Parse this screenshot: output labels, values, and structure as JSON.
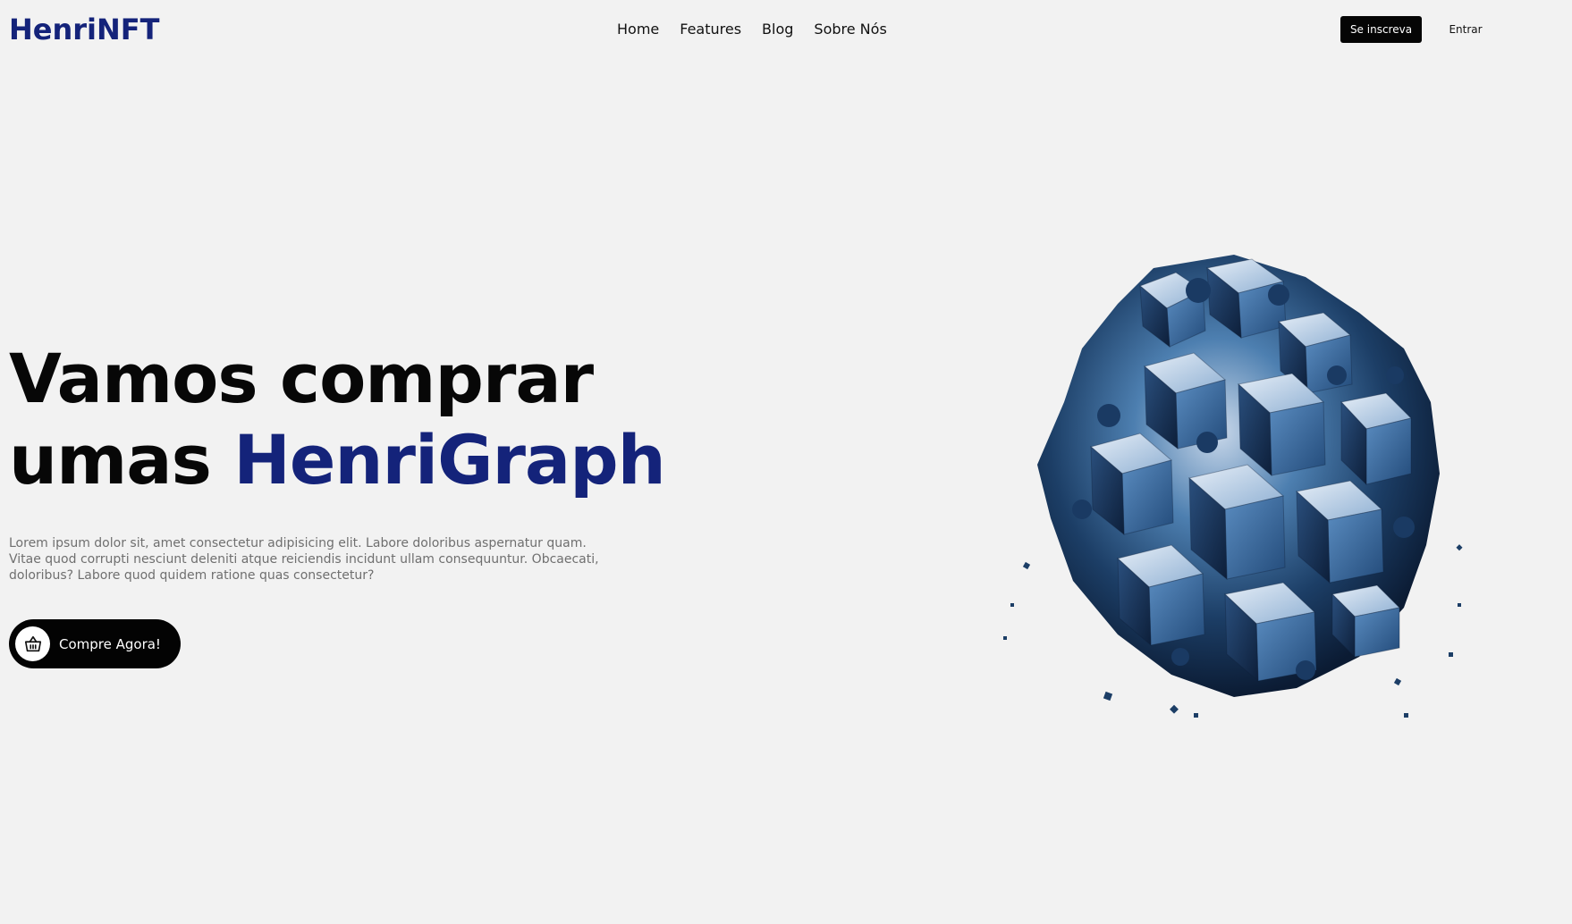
{
  "header": {
    "logo": "HenriNFT",
    "nav": [
      "Home",
      "Features",
      "Blog",
      "Sobre Nós"
    ],
    "signup_label": "Se inscreva",
    "login_label": "Entrar"
  },
  "hero": {
    "title_line1": "Vamos comprar",
    "title_line2_prefix": "umas ",
    "title_accent": "HenriGraph",
    "description": "Lorem ipsum dolor sit, amet consectetur adipisicing elit. Labore doloribus aspernatur quam. Vitae quod corrupti nesciunt deleniti atque reiciendis incidunt ullam consequuntur. Obcaecati, doloribus? Labore quod quidem ratione quas consectetur?",
    "cta_label": "Compre Agora!",
    "cta_icon": "basket-icon"
  },
  "colors": {
    "background": "#f2f2f2",
    "accent": "#14237a",
    "button_dark": "#050505",
    "text_muted": "#6f6f6f"
  }
}
